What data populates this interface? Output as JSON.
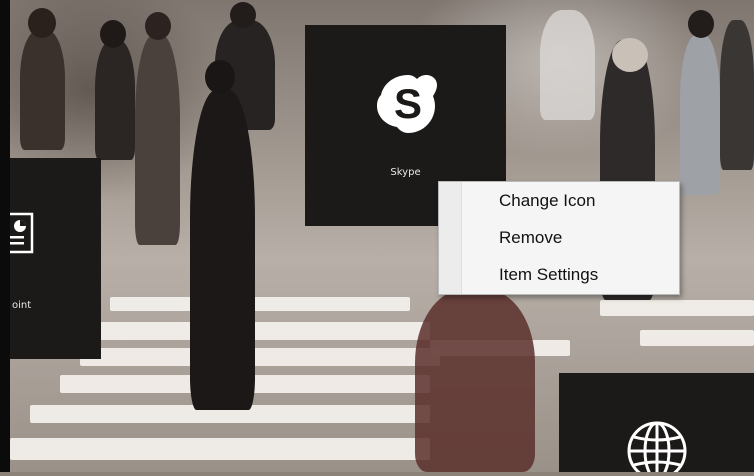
{
  "tiles": {
    "skype": {
      "label": "Skype",
      "icon": "skype-icon"
    },
    "powerpoint": {
      "label": "oint",
      "icon": "presentation-icon"
    },
    "browser": {
      "label": "",
      "icon": "globe-icon"
    }
  },
  "context_menu": {
    "items": [
      {
        "label": "Change Icon"
      },
      {
        "label": "Remove"
      },
      {
        "label": "Item Settings"
      }
    ]
  },
  "colors": {
    "tile_background": "#1c1a19",
    "menu_background": "#f5f5f5",
    "icon_color": "#ffffff"
  }
}
